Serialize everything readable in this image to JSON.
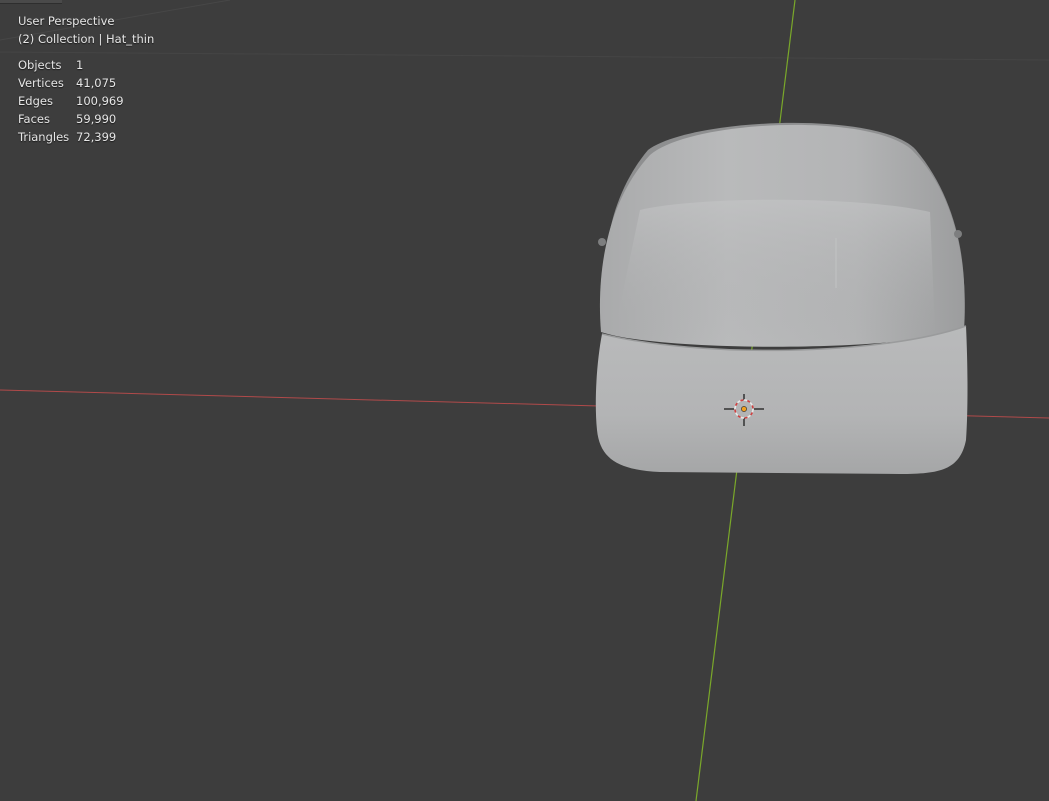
{
  "viewport": {
    "view_name": "User Perspective",
    "collection_prefix": "(2) Collection",
    "separator": "|",
    "active_object": "Hat_thin"
  },
  "stats": {
    "rows": [
      {
        "label": "Objects",
        "value": "1"
      },
      {
        "label": "Vertices",
        "value": "41,075"
      },
      {
        "label": "Edges",
        "value": "100,969"
      },
      {
        "label": "Faces",
        "value": "59,990"
      },
      {
        "label": "Triangles",
        "value": "72,399"
      }
    ]
  },
  "colors": {
    "background": "#3d3d3d",
    "x_axis": "#b04a4a",
    "y_axis": "#7aa82a",
    "mesh": "#b8b9ba",
    "cursor_ring": "#e8e8e8",
    "origin": "#f0a020"
  },
  "scene_objects": {
    "mesh_icon": "hat-mesh",
    "cursor_icon": "3d-cursor-icon",
    "origin_icon": "object-origin-icon"
  }
}
